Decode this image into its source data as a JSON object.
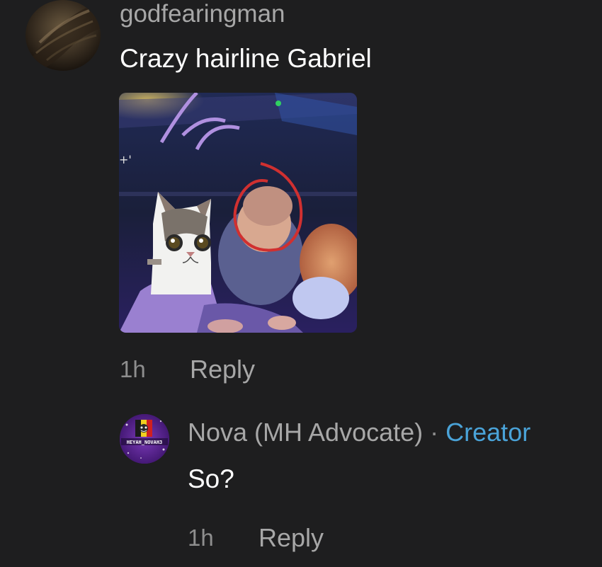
{
  "comment": {
    "username": "godfearingman",
    "text": "Crazy hairline Gabriel",
    "time": "1h",
    "reply_label": "Reply",
    "avatar_icon": "avatar-photo",
    "attachment_icon": "image-thumbnail"
  },
  "reply": {
    "username": "Nova (MH Advocate)",
    "separator": "·",
    "badge": "Creator",
    "text": "So?",
    "time": "1h",
    "reply_label": "Reply",
    "avatar_lettering": "HEYAH_NOVAH3",
    "badge_color": "#4aa3d8"
  },
  "colors": {
    "background": "#1e1e1f",
    "secondary_text": "#a7a7a7",
    "primary_text": "#ffffff",
    "creator_badge": "#4aa3d8"
  }
}
